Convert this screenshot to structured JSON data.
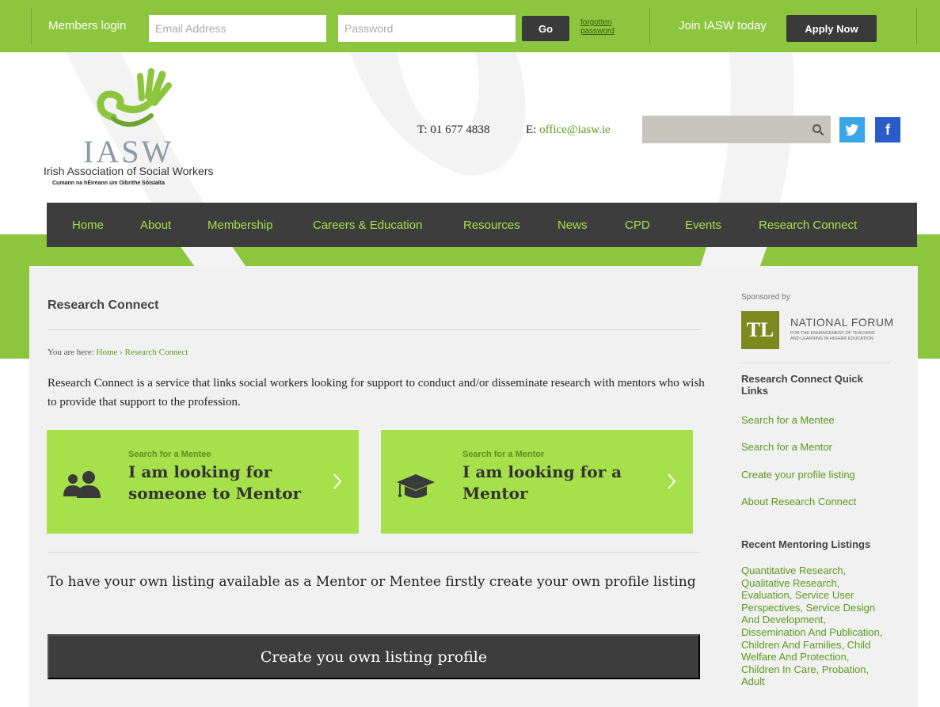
{
  "topbar": {
    "members_login": "Members login",
    "email_placeholder": "Email Address",
    "password_placeholder": "Password",
    "go_label": "Go",
    "forgotten_label": "forgotten password",
    "join_label": "Join IASW today",
    "apply_label": "Apply Now"
  },
  "header": {
    "logo_word": "IASW",
    "logo_full": "Irish Association of Social Workers",
    "logo_irish": "Cumann na hÉireann um Oibrithe Sóisialta",
    "phone_prefix": "T:",
    "phone": "01 677 4838",
    "email_prefix": "E:",
    "email": "office@iasw.ie",
    "social": {
      "twitter": "twitter-icon",
      "facebook_glyph": "f"
    }
  },
  "nav": {
    "items": [
      "Home",
      "About",
      "Membership",
      "Careers & Education",
      "Resources",
      "News",
      "CPD",
      "Events",
      "Research Connect"
    ]
  },
  "main": {
    "title": "Research Connect",
    "breadcrumb_prefix": "You are here:",
    "breadcrumb_home": "Home",
    "breadcrumb_sep": "›",
    "breadcrumb_current": "Research Connect",
    "intro": "Research Connect is a service that links social workers looking for support to conduct and/or disseminate research with mentors who wish to provide that support to the profession.",
    "cards": [
      {
        "small": "Search for a Mentee",
        "big": "I am looking for someone to Mentor"
      },
      {
        "small": "Search for a Mentor",
        "big": "I am looking for a Mentor"
      }
    ],
    "cta_text": "To have your own listing available as a Mentor or Mentee firstly create your own profile listing",
    "cta_button": "Create you own listing profile"
  },
  "sidebar": {
    "sponsored_by": "Sponsored by",
    "sponsor_logo": "TL",
    "sponsor_name": "NATIONAL FORUM",
    "sponsor_line1": "FOR THE ENHANCEMENT OF TEACHING",
    "sponsor_line2": "AND LEARNING IN HIGHER EDUCATION",
    "quick_links_heading": "Research Connect Quick Links",
    "quick_links": [
      "Search for a Mentee",
      "Search for a Mentor",
      "Create your profile listing",
      "About Research Connect"
    ],
    "recent_heading": "Recent Mentoring Listings",
    "recent_text": "Quantitative Research, Qualitative Research, Evaluation, Service User Perspectives, Service Design And Development, Dissemination And Publication, Children And Families, Child Welfare And Protection, Children In Care, Probation, Adult"
  },
  "colors": {
    "green": "#8cc63f",
    "light_green": "#a6e04a",
    "dark": "#3d3d3d",
    "link_green": "#5a9a1c"
  }
}
